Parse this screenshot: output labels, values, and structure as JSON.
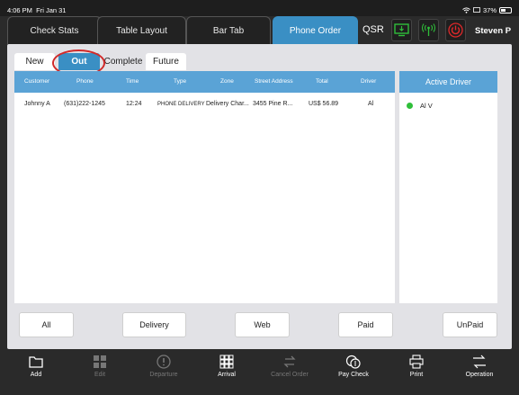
{
  "status": {
    "time": "4:06 PM",
    "date": "Fri Jan 31",
    "battery": "37%"
  },
  "nav": {
    "tabs": [
      "Check Stats",
      "Table Layout",
      "Bar Tab",
      "Phone Order"
    ],
    "qsr": "QSR",
    "user": "Steven P"
  },
  "subtabs": [
    "New",
    "Out",
    "Complete",
    "Future"
  ],
  "orders": {
    "headers": [
      "Customer",
      "Phone",
      "Time",
      "Type",
      "Zone",
      "Street Address",
      "Total",
      "Driver"
    ],
    "rows": [
      {
        "customer": "Johnny A",
        "phone": "(631)222-1245",
        "time": "12:24",
        "type": "PHONE DELIVERY",
        "zone": "Delivery Char...",
        "address": "3455   Pine R...",
        "total": "US$ 56.89",
        "driver": "Al"
      }
    ]
  },
  "drivers": {
    "title": "Active Driver",
    "items": [
      {
        "name": "Al V",
        "status_color": "#2fbf3a"
      }
    ]
  },
  "filters": [
    "All",
    "Delivery",
    "Web",
    "Paid",
    "UnPaid"
  ],
  "toolbar": [
    {
      "label": "Add",
      "icon": "folder-icon",
      "enabled": true
    },
    {
      "label": "Edit",
      "icon": "edit-grid-icon",
      "enabled": false
    },
    {
      "label": "Departure",
      "icon": "alert-icon",
      "enabled": false
    },
    {
      "label": "Arrival",
      "icon": "grid-icon",
      "enabled": true
    },
    {
      "label": "Cancel Order",
      "icon": "swap-icon",
      "enabled": false
    },
    {
      "label": "Pay Check",
      "icon": "coins-icon",
      "enabled": true
    },
    {
      "label": "Print",
      "icon": "printer-icon",
      "enabled": true
    },
    {
      "label": "Operation",
      "icon": "exchange-icon",
      "enabled": true
    }
  ],
  "colors": {
    "accent": "#3a8fc4",
    "header": "#5aa3d6",
    "highlight_circle": "#d12a2a",
    "active_green": "#2fbf3a",
    "power_red": "#e0282a"
  }
}
